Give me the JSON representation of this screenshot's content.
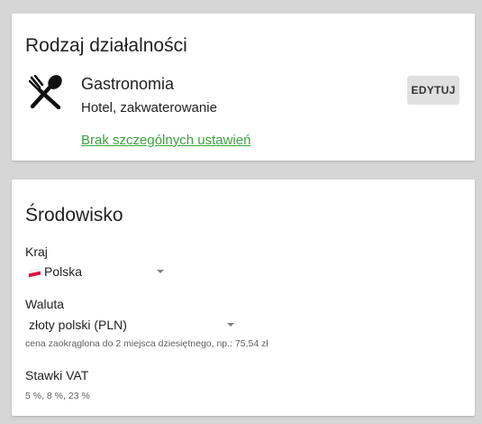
{
  "business": {
    "title": "Rodzaj działalności",
    "name": "Gastronomia",
    "subtitle": "Hotel, zakwaterowanie",
    "link": "Brak szczególnych ustawień",
    "edit_label": "EDYTUJ",
    "icon": "fork-spoon-icon"
  },
  "environment": {
    "title": "Środowisko",
    "country": {
      "label": "Kraj",
      "value": "Polska",
      "flag_icon": "poland-flag-icon"
    },
    "currency": {
      "label": "Waluta",
      "value": "złoty polski (PLN)",
      "hint": "cena zaokrąglona do 2 miejsca dziesiętnego, np.: 75,54 zł"
    },
    "vat": {
      "label": "Stawki VAT",
      "value": "5 %, 8 %, 23 %"
    }
  },
  "colors": {
    "background": "#d6d6d6",
    "card": "#ffffff",
    "link": "#3aa33d",
    "button": "#e0e0e0"
  }
}
